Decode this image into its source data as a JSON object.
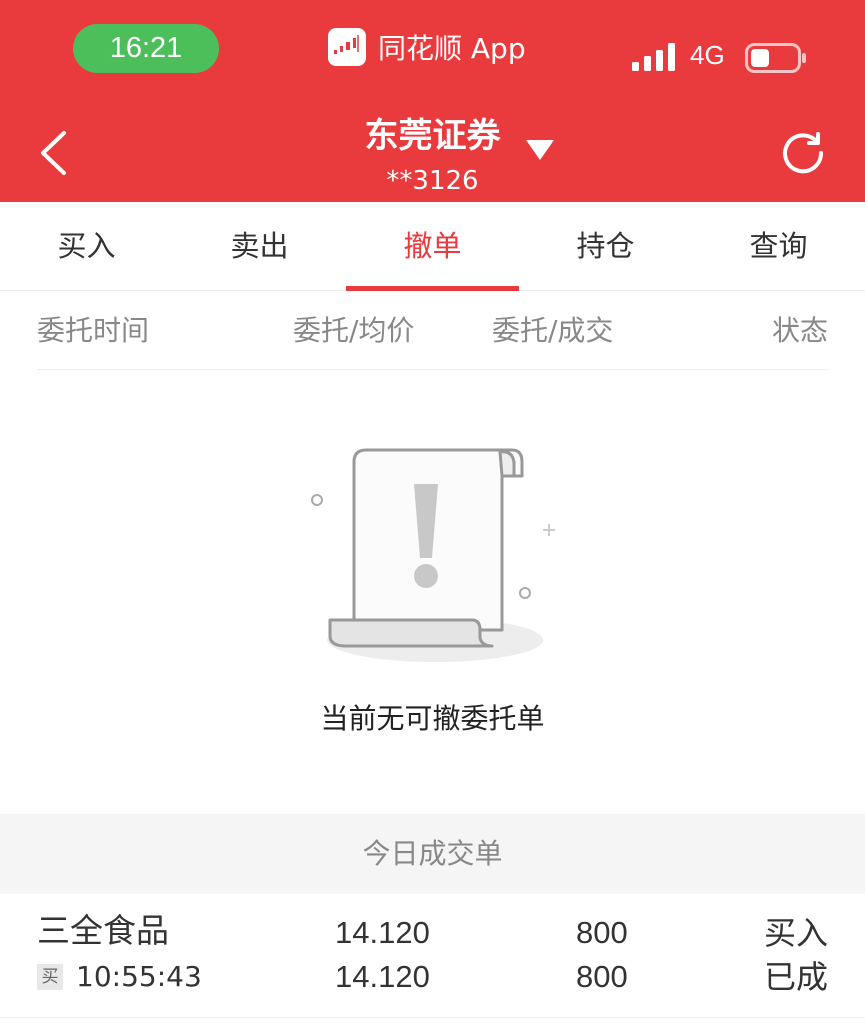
{
  "status_bar": {
    "time": "16:21",
    "app_name": "同花顺 App",
    "network": "4G",
    "icons": [
      "signal-bars-icon",
      "battery-icon"
    ]
  },
  "header": {
    "title": "东莞证券",
    "account": "**3126",
    "icons": [
      "back-chevron-icon",
      "dropdown-triangle-icon",
      "refresh-icon"
    ]
  },
  "tabs": [
    {
      "label": "买入"
    },
    {
      "label": "卖出"
    },
    {
      "label": "撤单",
      "active": true
    },
    {
      "label": "持仓"
    },
    {
      "label": "查询"
    }
  ],
  "columns": [
    "委托时间",
    "委托/均价",
    "委托/成交",
    "状态"
  ],
  "empty_state": {
    "message": "当前无可撤委托单",
    "icon": "empty-scroll-exclamation-icon"
  },
  "today_section": {
    "title": "今日成交单",
    "rows": [
      {
        "name": "三全食品",
        "tag": "买",
        "time": "10:55:43",
        "order_price": "14.120",
        "avg_price": "14.120",
        "order_qty": "800",
        "filled_qty": "800",
        "direction": "买入",
        "status": "已成"
      }
    ]
  },
  "colors": {
    "header_red": "#e93b3d",
    "status_green": "#4cbf5b",
    "active_tab": "#e93b3d",
    "muted_text": "#888888",
    "section_bg": "#f5f5f5"
  }
}
